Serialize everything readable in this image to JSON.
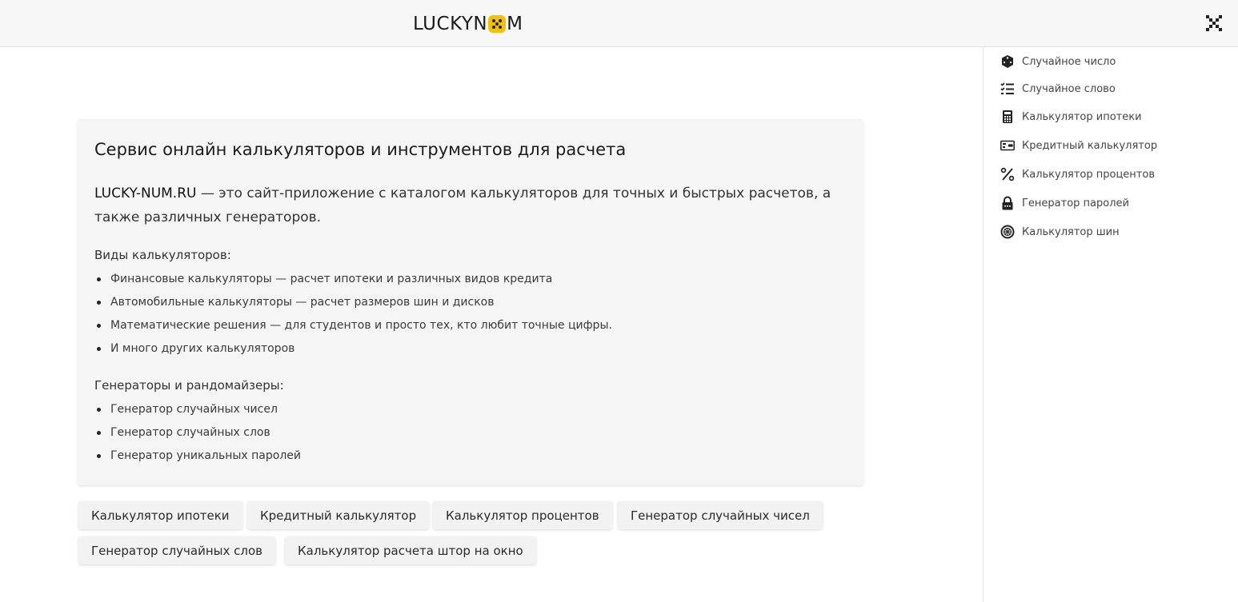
{
  "header": {
    "logo_text_before": "LUCKYN",
    "logo_text_after": "M",
    "brand_color": "#f2c200"
  },
  "sidebar": {
    "items": [
      {
        "label": "Случайное число",
        "icon": "dice-icon"
      },
      {
        "label": "Случайное слово",
        "icon": "checklist-icon"
      },
      {
        "label": "Калькулятор ипотеки",
        "icon": "calculator-icon"
      },
      {
        "label": "Кредитный калькулятор",
        "icon": "credit-card-icon"
      },
      {
        "label": "Калькулятор процентов",
        "icon": "percent-icon"
      },
      {
        "label": "Генератор паролей",
        "icon": "lock-icon"
      },
      {
        "label": "Калькулятор шин",
        "icon": "tire-icon"
      }
    ]
  },
  "main": {
    "title": "Сервис онлайн калькуляторов и инструментов для расчета",
    "intro_brand": "LUCKY-NUM.RU",
    "intro_rest": " — это сайт-приложение с каталогом калькуляторов для точных и быстрых расчетов, а также различных генераторов.",
    "calculators_title": "Виды калькуляторов:",
    "calculators": [
      "Финансовые калькуляторы — расчет ипотеки и различных видов кредита",
      "Автомобильные калькуляторы — расчет размеров шин и дисков",
      "Математические решения — для студентов и просто тех, кто любит точные цифры.",
      "И много других калькуляторов"
    ],
    "generators_title": "Генераторы и рандомайзеры:",
    "generators": [
      "Генератор случайных чисел",
      "Генератор случайных слов",
      "Генератор уникальных паролей"
    ],
    "chips": [
      "Калькулятор ипотеки",
      "Кредитный калькулятор",
      "Калькулятор процентов",
      "Генератор случайных чисел",
      "Генератор случайных слов",
      "Калькулятор расчета штор на окно"
    ]
  }
}
